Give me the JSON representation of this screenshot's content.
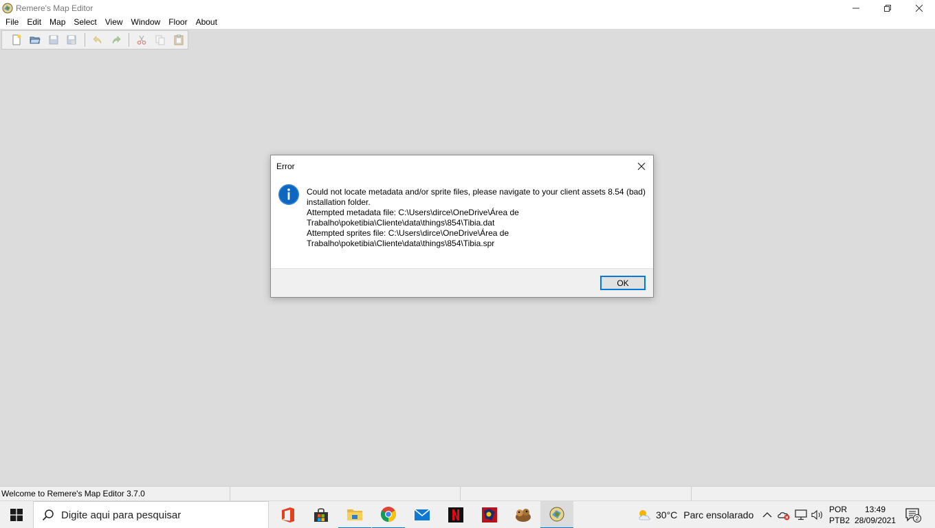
{
  "window": {
    "title": "Remere's Map Editor",
    "controls": [
      "minimize-icon",
      "restore-icon",
      "close-icon"
    ]
  },
  "menu": [
    "File",
    "Edit",
    "Map",
    "Select",
    "View",
    "Window",
    "Floor",
    "About"
  ],
  "toolbar": {
    "buttons": [
      "new-file-icon",
      "open-folder-icon",
      "save-icon",
      "save-as-icon",
      "undo-icon",
      "redo-icon",
      "cut-icon",
      "copy-icon",
      "paste-icon"
    ]
  },
  "dialog": {
    "title": "Error",
    "icon": "info-icon",
    "message_lines": [
      "Could not locate metadata and/or sprite files, please navigate to your client assets 8.54 (bad)",
      "installation folder.",
      "Attempted metadata file: C:\\Users\\dirce\\OneDrive\\Área de",
      "Trabalho\\poketibia\\Cliente\\data\\things\\854\\Tibia.dat",
      "Attempted sprites file: C:\\Users\\dirce\\OneDrive\\Área de",
      "Trabalho\\poketibia\\Cliente\\data\\things\\854\\Tibia.spr"
    ],
    "ok_label": "OK"
  },
  "statusbar": {
    "message": "Welcome to Remere's Map Editor 3.7.0"
  },
  "taskbar": {
    "search_placeholder": "Digite aqui para pesquisar",
    "apps": [
      "office-icon",
      "store-icon",
      "file-explorer-icon",
      "chrome-icon",
      "mail-icon",
      "netflix-icon",
      "game-icon",
      "game-icon-2",
      "map-editor-icon"
    ],
    "weather_temp": "30°C",
    "weather_desc": "Parc ensolarado",
    "lang_line1": "POR",
    "lang_line2": "PTB2",
    "time": "13:49",
    "date": "28/09/2021",
    "notification_count": "2"
  },
  "colors": {
    "accent": "#0078d7",
    "workspace": "#dcdcdc"
  }
}
